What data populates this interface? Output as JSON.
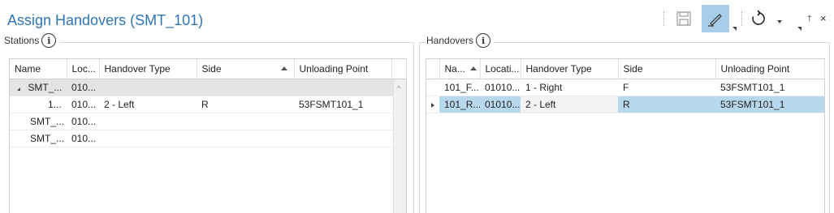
{
  "title": "Assign Handovers (SMT_101)",
  "toolbar": {
    "save_icon": "save-icon",
    "edit_icon": "pencil-icon",
    "refresh_icon": "refresh-icon",
    "pin_glyph": "†",
    "close_glyph": "×"
  },
  "stations": {
    "label": "Stations",
    "columns": [
      "Name",
      "Loc...",
      "Handover Type",
      "Side",
      "Unloading Point"
    ],
    "rows": [
      {
        "name": "SMT_...",
        "loc": "010...",
        "handover_type": "",
        "side": "",
        "unloading_point": ""
      },
      {
        "name": "1...",
        "loc": "010...",
        "handover_type": "2 - Left",
        "side": "R",
        "unloading_point": "53FSMT101_1"
      },
      {
        "name": "SMT_...",
        "loc": "010...",
        "handover_type": "",
        "side": "",
        "unloading_point": ""
      },
      {
        "name": "SMT_...",
        "loc": "010...",
        "handover_type": "",
        "side": "",
        "unloading_point": ""
      }
    ]
  },
  "handovers": {
    "label": "Handovers",
    "columns": [
      "Na...",
      "Locati...",
      "Handover Type",
      "Side",
      "Unloading Point"
    ],
    "rows": [
      {
        "name": "101_F...",
        "loc": "01010...",
        "handover_type": "1 - Right",
        "side": "F",
        "unloading_point": "53FSMT101_1"
      },
      {
        "name": "101_R...",
        "loc": "01010...",
        "handover_type": "2 - Left",
        "side": "R",
        "unloading_point": "53FSMT101_1"
      }
    ]
  },
  "colors": {
    "accent": "#2e75b6",
    "selected_row": "#b8d8ee",
    "active_button": "#a8cde8"
  }
}
